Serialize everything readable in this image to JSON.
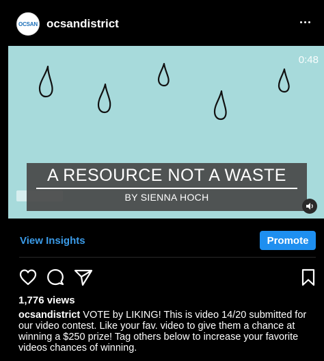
{
  "post": {
    "username": "ocsandistrict",
    "avatar_text": "OCSAN",
    "more_icon": "more-horizontal-icon"
  },
  "video": {
    "duration": "0:48",
    "title": "A RESOURCE NOT A WASTE",
    "subtitle": "BY SIENNA HOCH",
    "background_color": "#a7dadb",
    "sound_icon": "speaker-icon"
  },
  "insights": {
    "link_label": "View Insights",
    "promote_label": "Promote",
    "accent_color": "#1e8ff0"
  },
  "actions": {
    "like_icon": "heart-icon",
    "comment_icon": "comment-icon",
    "share_icon": "send-icon",
    "save_icon": "bookmark-icon"
  },
  "stats": {
    "views": "1,776 views"
  },
  "caption": {
    "username": "ocsandistrict",
    "text": " VOTE by LIKING! This is video 14/20 submitted for our video contest. Like your fav. video to give them a chance at winning a $250 prize! Tag others below to increase your favorite videos chances of winning."
  }
}
